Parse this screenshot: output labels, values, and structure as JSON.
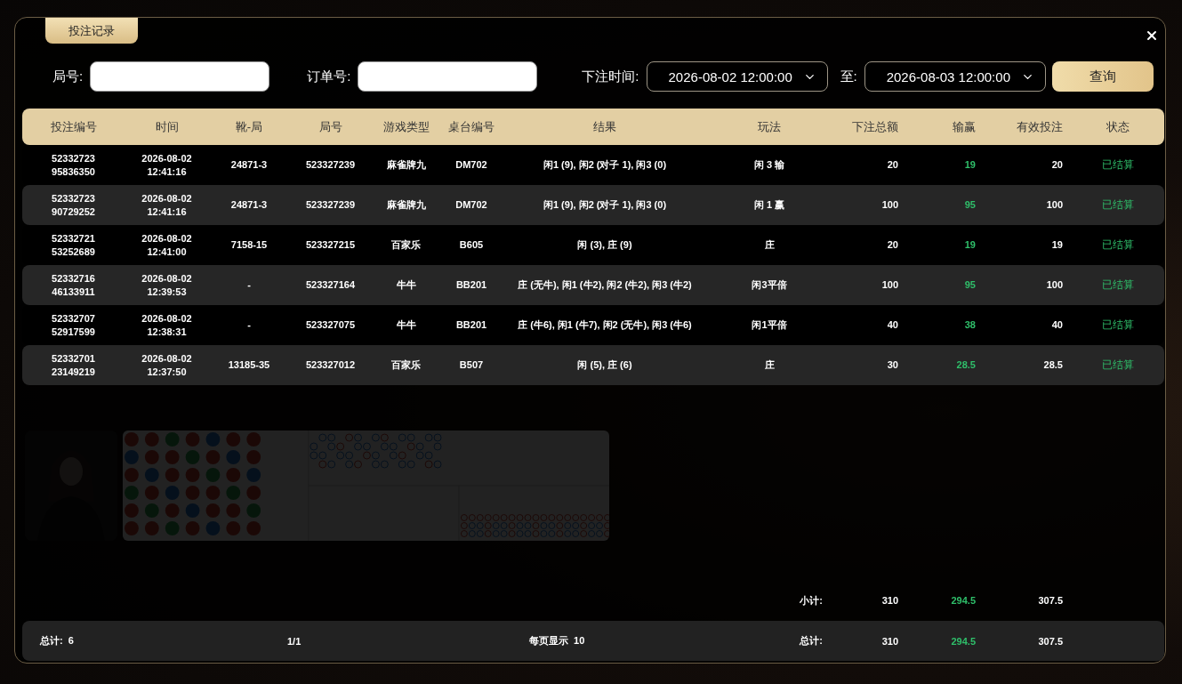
{
  "dialog": {
    "tab": "投注记录",
    "filters": {
      "round_label": "局号:",
      "order_label": "订单号:",
      "time_label": "下注时间:",
      "time_from": "2026-08-02 12:00:00",
      "to_label": "至:",
      "time_to": "2026-08-03 12:00:00",
      "query_button": "查询"
    },
    "table": {
      "columns": [
        "投注编号",
        "时间",
        "靴-局",
        "局号",
        "游戏类型",
        "桌台编号",
        "结果",
        "玩法",
        "下注总额",
        "输赢",
        "有效投注",
        "状态"
      ],
      "rows": [
        {
          "bet_no": "5233272395836350",
          "time": "2026-08-02 12:41:16",
          "shoe": "24871-3",
          "round": "523327239",
          "game": "麻雀牌九",
          "table": "DM702",
          "result": "闲1 (9), 闲2 (对子 1), 闲3 (0)",
          "play": "闲 3 输",
          "amount": "20",
          "win": "19",
          "valid": "20",
          "status": "已结算"
        },
        {
          "bet_no": "5233272390729252",
          "time": "2026-08-02 12:41:16",
          "shoe": "24871-3",
          "round": "523327239",
          "game": "麻雀牌九",
          "table": "DM702",
          "result": "闲1 (9), 闲2 (对子 1), 闲3 (0)",
          "play": "闲 1 赢",
          "amount": "100",
          "win": "95",
          "valid": "100",
          "status": "已结算"
        },
        {
          "bet_no": "5233272153252689",
          "time": "2026-08-02 12:41:00",
          "shoe": "7158-15",
          "round": "523327215",
          "game": "百家乐",
          "table": "B605",
          "result": "闲 (3), 庄 (9)",
          "play": "庄",
          "amount": "20",
          "win": "19",
          "valid": "19",
          "status": "已结算"
        },
        {
          "bet_no": "5233271646133911",
          "time": "2026-08-02 12:39:53",
          "shoe": "-",
          "round": "523327164",
          "game": "牛牛",
          "table": "BB201",
          "result": "庄 (无牛), 闲1 (牛2), 闲2 (牛2), 闲3 (牛2)",
          "play": "闲3平倍",
          "amount": "100",
          "win": "95",
          "valid": "100",
          "status": "已结算"
        },
        {
          "bet_no": "5233270752917599",
          "time": "2026-08-02 12:38:31",
          "shoe": "-",
          "round": "523327075",
          "game": "牛牛",
          "table": "BB201",
          "result": "庄 (牛6), 闲1 (牛7), 闲2 (无牛), 闲3 (牛6)",
          "play": "闲1平倍",
          "amount": "40",
          "win": "38",
          "valid": "40",
          "status": "已结算"
        },
        {
          "bet_no": "5233270123149219",
          "time": "2026-08-02 12:37:50",
          "shoe": "13185-35",
          "round": "523327012",
          "game": "百家乐",
          "table": "B507",
          "result": "闲 (5), 庄 (6)",
          "play": "庄",
          "amount": "30",
          "win": "28.5",
          "valid": "28.5",
          "status": "已结算"
        }
      ]
    },
    "subtotal": {
      "label": "小计:",
      "amount": "310",
      "win": "294.5",
      "valid": "307.5"
    },
    "footer": {
      "count": "总计:  6",
      "pages": "1/1",
      "per_page": "每页显示  10",
      "label": "总计:",
      "amount": "310",
      "win": "294.5",
      "valid": "307.5"
    }
  }
}
